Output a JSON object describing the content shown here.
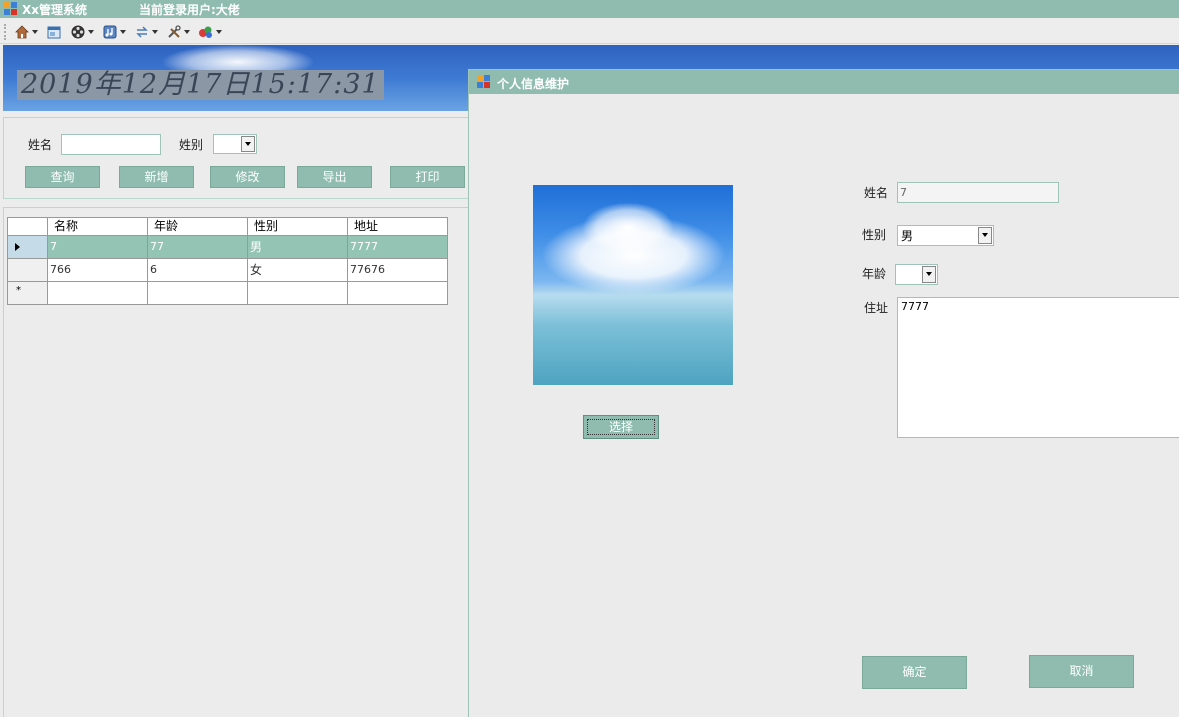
{
  "titlebar": {
    "app_name": "Xx管理系统",
    "current_user": "当前登录用户:大佬"
  },
  "toolbar": {
    "buttons": [
      {
        "icon": "home-icon"
      },
      {
        "icon": "window-icon"
      },
      {
        "icon": "film-reel-icon"
      },
      {
        "icon": "media-icon"
      },
      {
        "icon": "transfer-icon"
      },
      {
        "icon": "tools-icon"
      },
      {
        "icon": "colors-icon"
      }
    ]
  },
  "banner": {
    "clock": "2019年12月17日15:17:31"
  },
  "search": {
    "name_label": "姓名",
    "name_value": "",
    "gender_label": "姓别",
    "gender_value": "",
    "buttons": {
      "query": "查询",
      "add": "新增",
      "edit": "修改",
      "export": "导出",
      "print": "打印"
    }
  },
  "grid": {
    "columns": [
      "名称",
      "年龄",
      "性别",
      "地址"
    ],
    "rows": [
      {
        "name": "7",
        "age": "77",
        "gender": "男",
        "address": "7777",
        "selected": true
      },
      {
        "name": "766",
        "age": "6",
        "gender": "女",
        "address": "77676",
        "selected": false
      }
    ],
    "new_row_marker": "*"
  },
  "dialog": {
    "title": "个人信息维护",
    "choose_button": "选择",
    "name_label": "姓名",
    "name_value": "7",
    "gender_label": "性别",
    "gender_value": "男",
    "age_label": "年龄",
    "age_value": "",
    "address_label": "住址",
    "address_value": "7777",
    "ok_button": "确定",
    "cancel_button": "取消"
  },
  "colors": {
    "accent": "#8fbcae",
    "banner": "#3e7ad3",
    "clock_bg": "#8c97a6"
  }
}
